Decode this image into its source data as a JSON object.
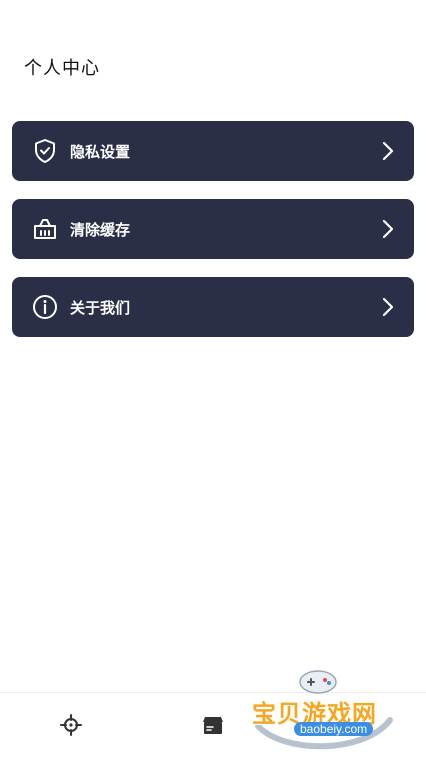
{
  "header": {
    "title": "个人中心"
  },
  "menu": {
    "items": [
      {
        "label": "隐私设置",
        "icon": "shield-check-icon"
      },
      {
        "label": "清除缓存",
        "icon": "basket-icon"
      },
      {
        "label": "关于我们",
        "icon": "info-icon"
      }
    ]
  },
  "tabbar": {
    "tabs": [
      {
        "icon": "crosshair-icon"
      },
      {
        "icon": "box-icon"
      }
    ]
  },
  "watermark": {
    "title": "宝贝游戏网",
    "domain": "baobeiy.com"
  },
  "colors": {
    "card_bg": "#2a2f47",
    "card_text": "#ffffff",
    "page_bg": "#ffffff",
    "title_text": "#111111",
    "watermark_orange": "#f5a623",
    "watermark_blue": "#3a8ee6"
  }
}
